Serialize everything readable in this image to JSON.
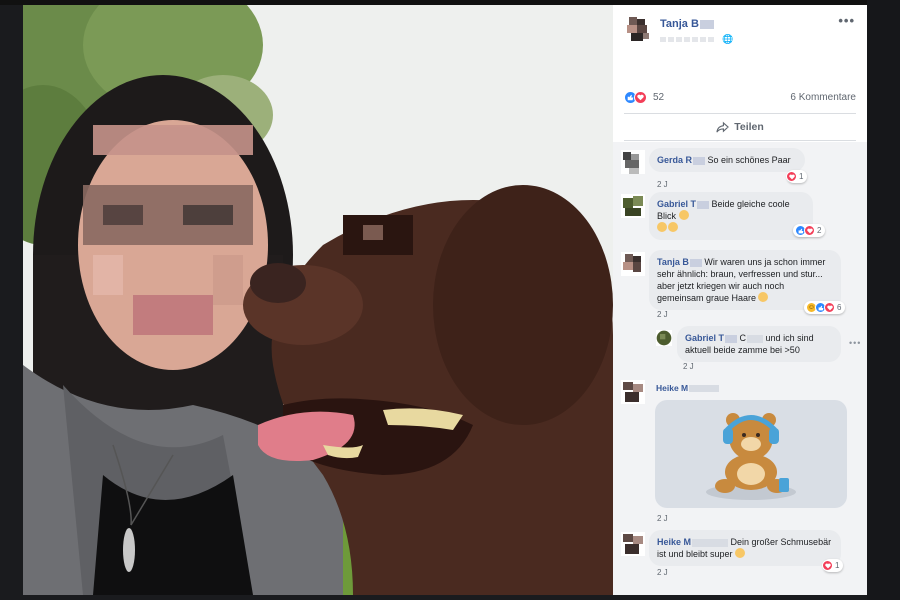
{
  "post": {
    "author": "Tanja B",
    "more_label": "•••",
    "reaction_count": "52",
    "comment_count": "6 Kommentare",
    "share_label": "Teilen",
    "globe_glyph": "🌐"
  },
  "comments": [
    {
      "author": "Gerda R",
      "text": "So ein schönes Paar",
      "time": "2 J",
      "reactions": "1"
    },
    {
      "author": "Gabriel T",
      "text": "Beide gleiche coole Blick",
      "time": "2 J",
      "reactions": "2"
    },
    {
      "author": "Tanja B",
      "text": "Wir waren uns ja schon immer sehr ähnlich: braun, verfressen und stur... aber jetzt kriegen wir auch noch gemeinsam graue Haare",
      "time": "2 J",
      "reactions": "6"
    },
    {
      "author": "Gabriel T",
      "text_a": "C",
      "text_b": "und ich sind aktuell beide zamme bei >50",
      "time": "2 J"
    },
    {
      "author": "Heike M",
      "time": "2 J"
    },
    {
      "author": "Heike M",
      "text": "Dein großer Schmusebär ist und bleibt super",
      "time": "2 J",
      "reactions": "1"
    }
  ],
  "colors": {
    "link": "#385898",
    "like": "#2d88ff",
    "love": "#f33e58",
    "haha": "#f7b928",
    "bubble": "#e9ebee"
  },
  "icons": {
    "like": "thumbs-up-icon",
    "love": "heart-icon",
    "haha": "laughing-face-icon",
    "share": "share-arrow-icon"
  }
}
